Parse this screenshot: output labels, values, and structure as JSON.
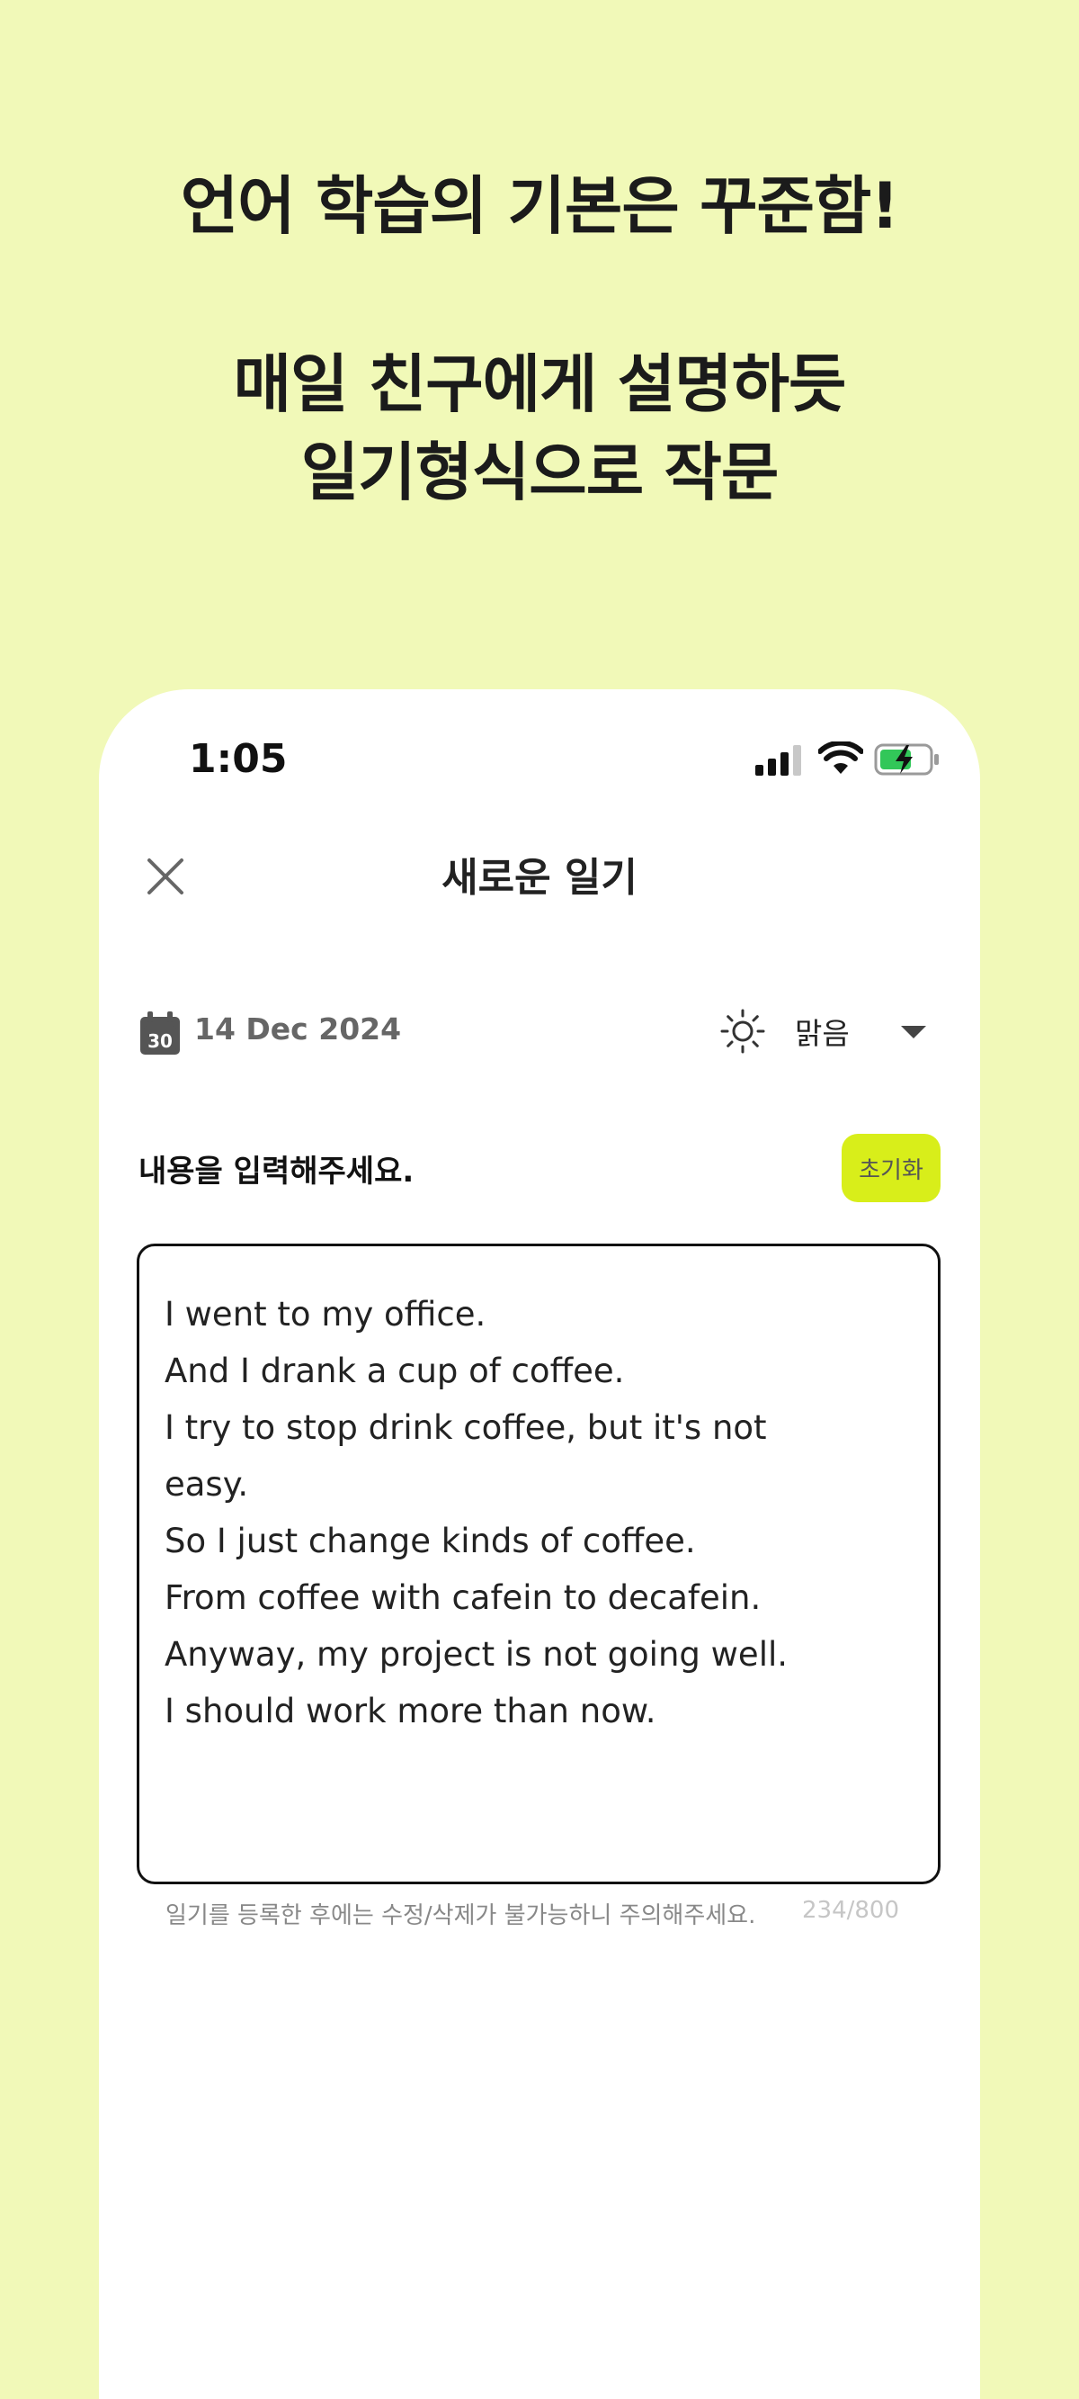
{
  "promo": {
    "line1": "언어 학습의 기본은 꾸준함!",
    "line2": "매일 친구에게 설명하듯",
    "line3": "일기형식으로 작문"
  },
  "status_bar": {
    "time": "1:05",
    "icons": [
      "signal-icon",
      "wifi-icon",
      "battery-charging-icon"
    ]
  },
  "header": {
    "title": "새로운 일기",
    "close_icon": "close-icon"
  },
  "meta": {
    "date": "14 Dec 2024",
    "calendar_day": "30",
    "weather_icon": "sun-icon",
    "weather": "맑음"
  },
  "editor": {
    "prompt": "내용을 입력해주세요.",
    "reset_label": "초기화",
    "lines": [
      "I went to my office.",
      "And I drank a cup of coffee.",
      "I try to stop drink coffee, but it's not",
      "easy.",
      "So I just change kinds of coffee.",
      "From coffee with cafein to decafein.",
      "Anyway, my project is not going well.",
      "I should work more than now."
    ],
    "hint": "일기를 등록한 후에는 수정/삭제가 불가능하니 주의해주세요.",
    "counter": "234/800"
  },
  "colors": {
    "background": "#F1F9B8",
    "accent": "#D8EE1A",
    "battery": "#32C759"
  }
}
